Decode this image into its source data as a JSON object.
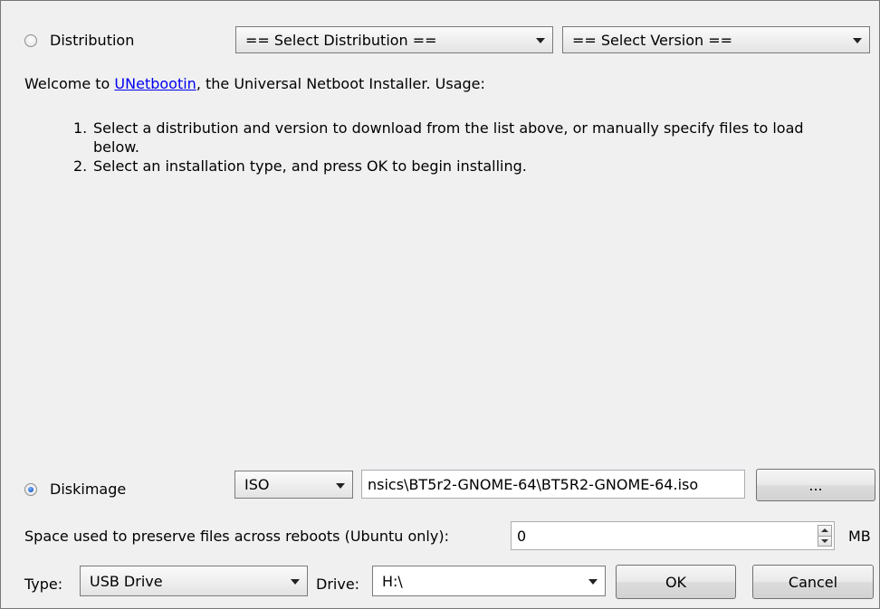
{
  "distribution": {
    "radio_label": "Distribution",
    "distribution_select": "== Select Distribution ==",
    "version_select": "== Select Version =="
  },
  "welcome": {
    "prefix": "Welcome to ",
    "link": "UNetbootin",
    "suffix": ", the Universal Netboot Installer. Usage:",
    "steps": [
      "Select a distribution and version to download from the list above, or manually specify files to load below.",
      "Select an installation type, and press OK to begin installing."
    ]
  },
  "diskimage": {
    "radio_label": "Diskimage",
    "type_select": "ISO",
    "path": "nsics\\BT5r2-GNOME-64\\BT5R2-GNOME-64.iso",
    "browse_label": "..."
  },
  "persistence": {
    "label": "Space used to preserve files across reboots (Ubuntu only):",
    "value": "0",
    "unit": "MB"
  },
  "footer": {
    "type_label": "Type:",
    "type_value": "USB Drive",
    "drive_label": "Drive:",
    "drive_value": "H:\\",
    "ok_label": "OK",
    "cancel_label": "Cancel"
  },
  "colors": {
    "link": "#0000ee",
    "radio_selected": "#1c5fd1"
  }
}
